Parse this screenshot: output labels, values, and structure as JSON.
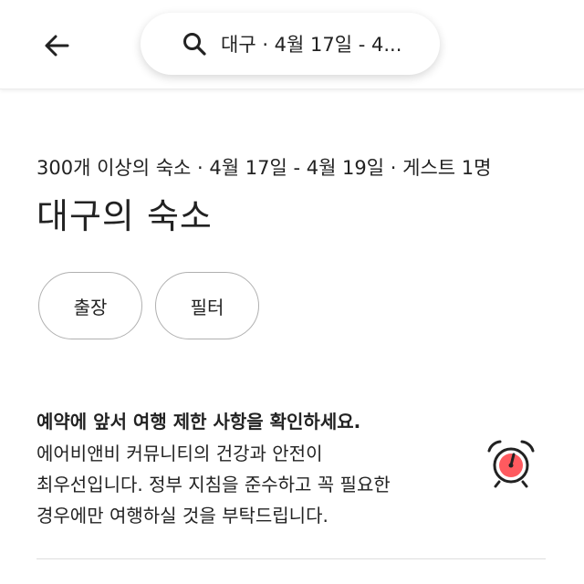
{
  "header": {
    "search_summary": "대구 · 4월 17일 - 4...",
    "icons": {
      "back": "arrow-left-icon",
      "search": "search-icon"
    }
  },
  "results": {
    "meta": "300개 이상의 숙소 · 4월 17일 - 4월 19일 · 게스트 1명",
    "title": "대구의 숙소"
  },
  "chips": [
    {
      "label": "출장"
    },
    {
      "label": "필터"
    }
  ],
  "notice": {
    "title": "예약에 앞서 여행 제한 사항을 확인하세요.",
    "lines": [
      "에어비앤비 커뮤니티의 건강과 안전이",
      "최우선입니다. 정부 지침을 준수하고 꼭 필요한",
      "경우에만 여행하실 것을 부탁드립니다."
    ],
    "icon": "alarm-clock-icon"
  },
  "colors": {
    "text": "#222222",
    "accent": "#ff5a5f",
    "border": "#b0b0b0",
    "divider": "#dddddd"
  }
}
